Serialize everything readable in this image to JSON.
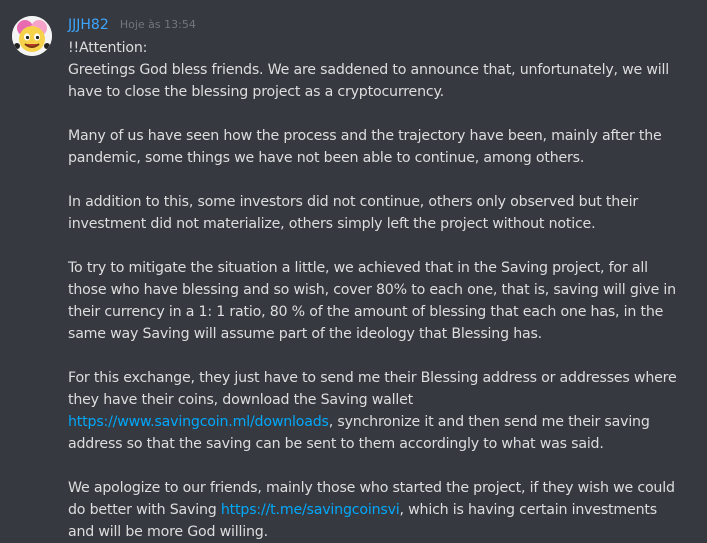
{
  "message": {
    "author": "JJJH82",
    "timestamp": "Hoje às 13:54",
    "avatar_icon": "cartoon-face-avatar",
    "colors": {
      "username": "#3ea6ff",
      "link": "#00a8fc",
      "background": "#36393f",
      "text": "#dcddde"
    },
    "line_attention": "!!Attention:",
    "line_greetings": "Greetings God bless friends. We are saddened to announce that, unfortunately, we will have to close the blessing project as a cryptocurrency.",
    "paragraph_2": "Many of us have seen how the process and the trajectory have been, mainly after the pandemic, some things we have not been able to continue, among others.",
    "paragraph_3": "In addition to this, some investors did not continue, others only observed but their investment did not materialize, others simply left the project without notice.",
    "paragraph_4": "To try to mitigate the situation a little, we achieved that in the Saving project, for all those who have blessing and so wish, cover 80% to each one, that is, saving will give in their currency in a 1: 1 ratio, 80 % of the amount of blessing that each one has, in the same way Saving will assume part of the ideology that Blessing has.",
    "paragraph_5_before": "For this exchange, they just have to send me their Blessing address or addresses where they have their coins, download the Saving wallet ",
    "paragraph_5_link": "https://www.savingcoin.ml/downloads",
    "paragraph_5_after": ", synchronize it and then send me their saving address so that the saving can be sent to them accordingly to what was said.",
    "paragraph_6_before": "We apologize to our friends, mainly those who started the project, if they wish we could do better with Saving ",
    "paragraph_6_link": "https://t.me/savingcoinsvi",
    "paragraph_6_after": ", which is having certain investments and will be more God willing."
  }
}
